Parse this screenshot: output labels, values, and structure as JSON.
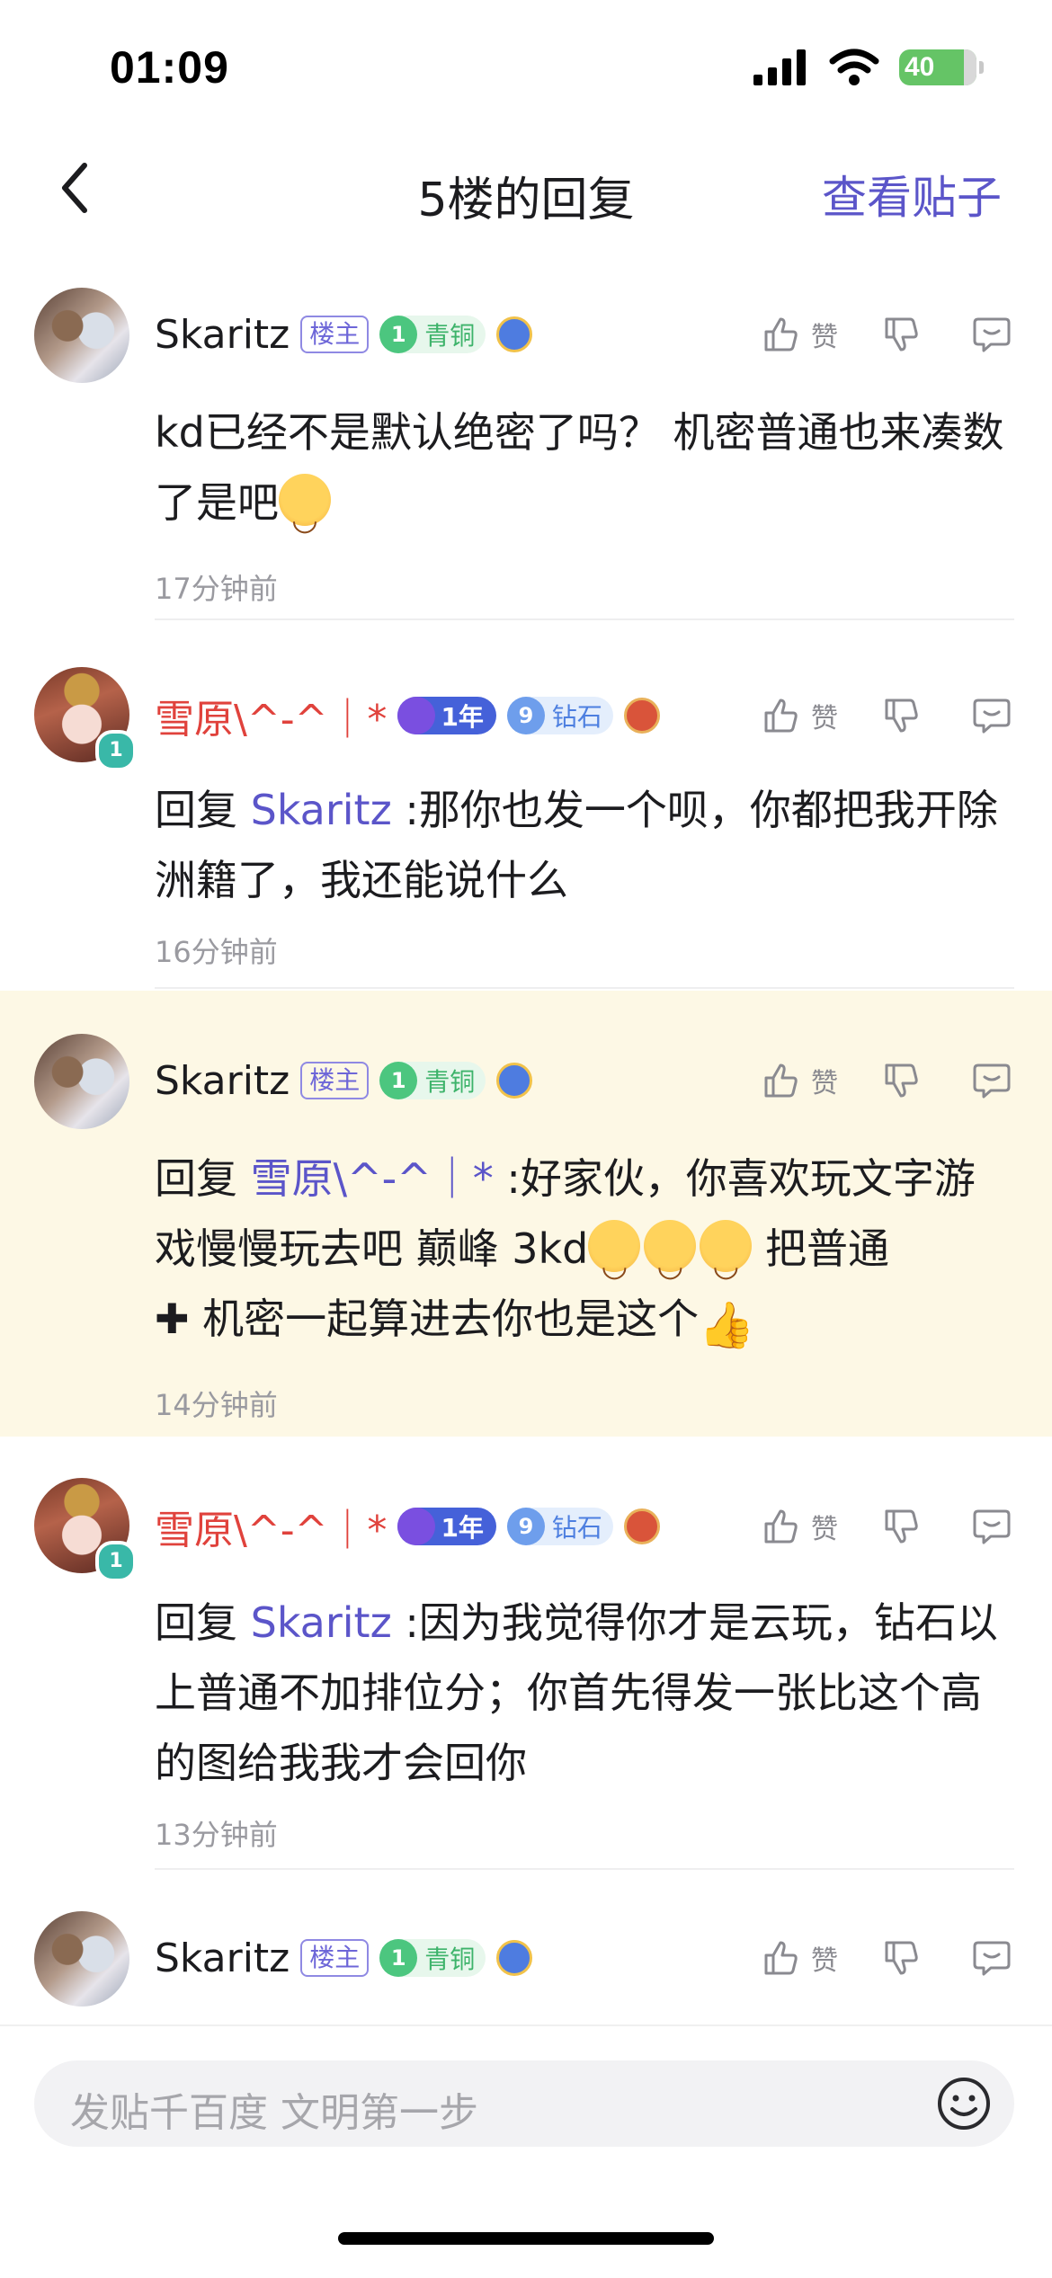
{
  "status_bar": {
    "time": "01:09",
    "battery": "40"
  },
  "nav": {
    "title": "5楼的回复",
    "view_post": "查看贴子"
  },
  "labels": {
    "owner_tag": "楼主",
    "like": "赞"
  },
  "comments": [
    {
      "user": "Skaritz",
      "rank_level": "1",
      "rank_name": "青铜",
      "body": "kd已经不是默认绝密了吗？ 机密普通也来凑数了是吧",
      "time": "17分钟前"
    },
    {
      "user": "雪原\\^-^｜*",
      "avatar_level": "1",
      "year_tag": "1年",
      "rank_level": "9",
      "rank_name": "钻石",
      "reply_prefix": "回复 ",
      "mention": "Skaritz",
      "body": " :那你也发一个呗，你都把我开除洲籍了，我还能说什么",
      "time": "16分钟前"
    },
    {
      "user": "Skaritz",
      "rank_level": "1",
      "rank_name": "青铜",
      "reply_prefix": "回复 ",
      "mention": "雪原\\^-^｜*",
      "body_part1": " :好家伙，你喜欢玩文字游戏慢慢玩去吧 巅峰 3kd",
      "body_part2": " 把普通",
      "body_part3": " 机密一起算进去你也是这个",
      "time": "14分钟前"
    },
    {
      "user": "雪原\\^-^｜*",
      "avatar_level": "1",
      "year_tag": "1年",
      "rank_level": "9",
      "rank_name": "钻石",
      "reply_prefix": "回复 ",
      "mention": "Skaritz",
      "body": " :因为我觉得你才是云玩，钻石以上普通不加排位分；你首先得发一张比这个高的图给我我才会回你",
      "time": "13分钟前"
    },
    {
      "user": "Skaritz",
      "rank_level": "1",
      "rank_name": "青铜"
    }
  ],
  "input": {
    "placeholder": "发贴千百度 文明第一步"
  },
  "colors": {
    "accent": "#5b55c9",
    "highlight_bg": "#fdf8e5",
    "name_red": "#e0423c",
    "rank_green": "#3db36a"
  }
}
